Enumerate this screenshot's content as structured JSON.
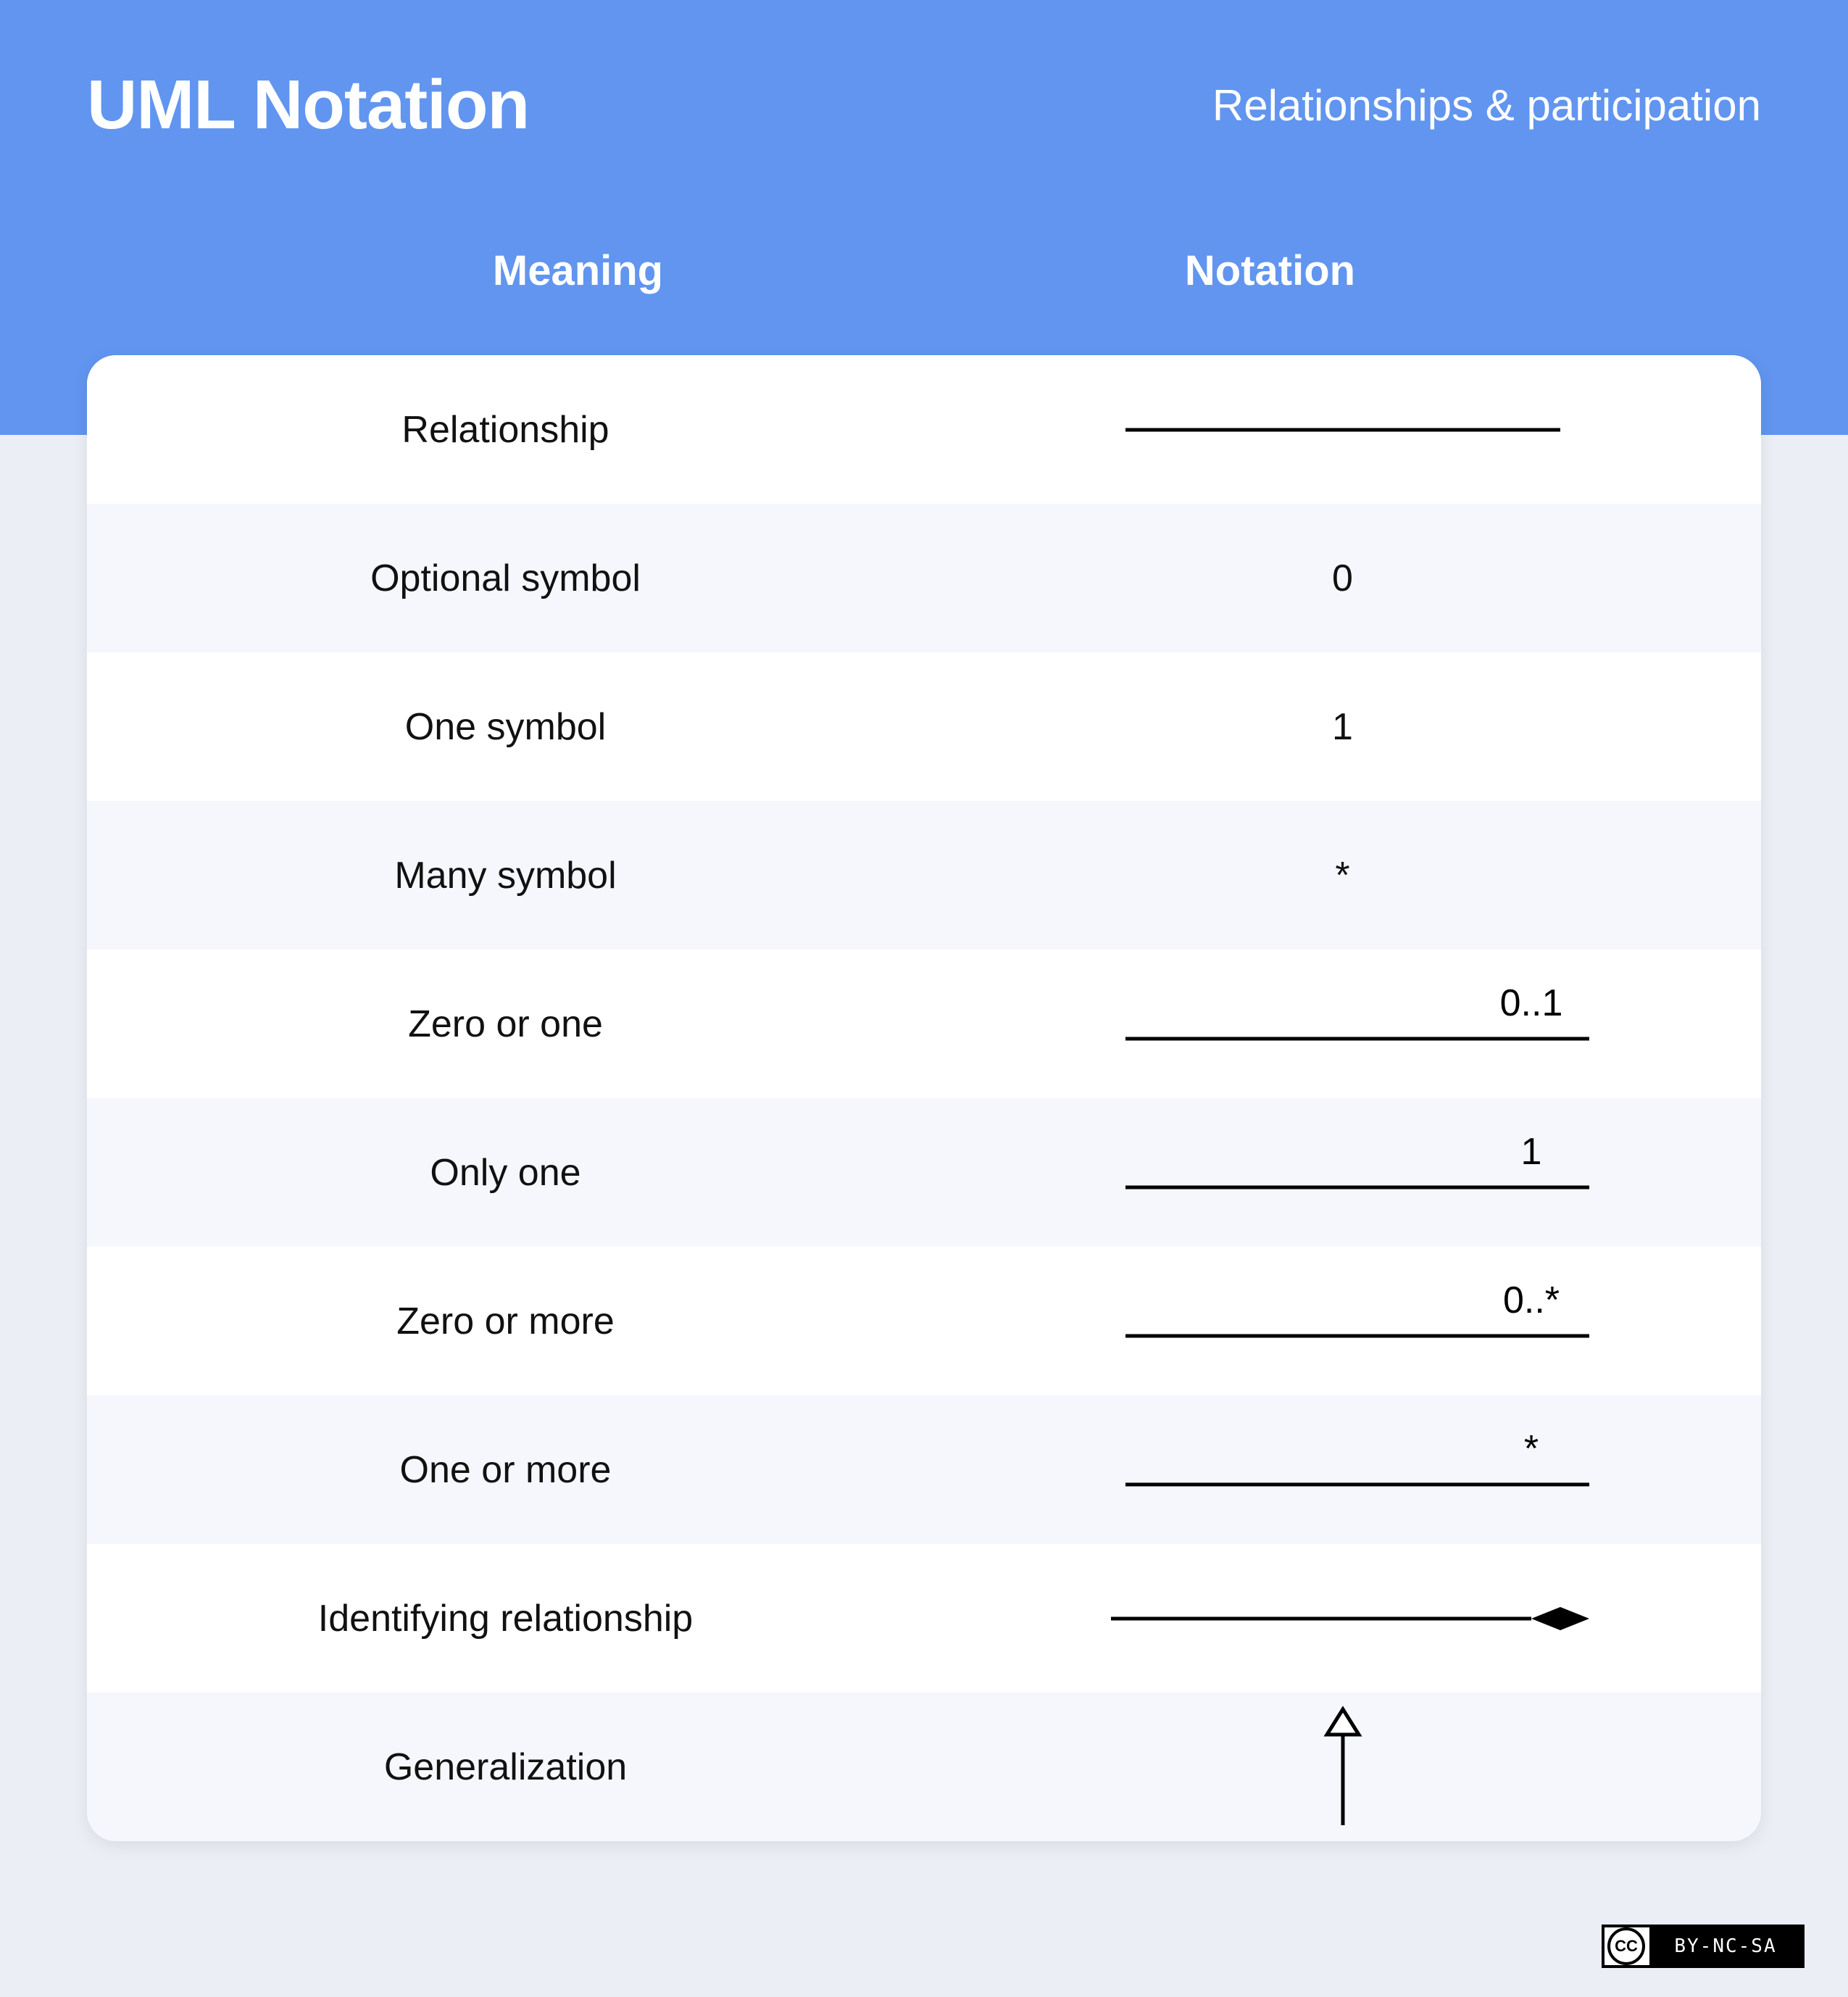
{
  "header": {
    "title": "UML Notation",
    "subtitle": "Relationships & participation",
    "col_meaning": "Meaning",
    "col_notation": "Notation"
  },
  "rows": [
    {
      "meaning": "Relationship",
      "notation_kind": "line",
      "label": ""
    },
    {
      "meaning": "Optional symbol",
      "notation_kind": "text",
      "label": "0"
    },
    {
      "meaning": "One symbol",
      "notation_kind": "text",
      "label": "1"
    },
    {
      "meaning": "Many symbol",
      "notation_kind": "text",
      "label": "*"
    },
    {
      "meaning": "Zero or one",
      "notation_kind": "line_label",
      "label": "0..1"
    },
    {
      "meaning": "Only one",
      "notation_kind": "line_label",
      "label": "1"
    },
    {
      "meaning": "Zero or more",
      "notation_kind": "line_label",
      "label": "0..*"
    },
    {
      "meaning": "One or more",
      "notation_kind": "line_label",
      "label": "*"
    },
    {
      "meaning": "Identifying relationship",
      "notation_kind": "line_diamond",
      "label": ""
    },
    {
      "meaning": "Generalization",
      "notation_kind": "arrow_up",
      "label": ""
    }
  ],
  "license": {
    "badge": "CC",
    "text": "BY-NC-SA"
  }
}
